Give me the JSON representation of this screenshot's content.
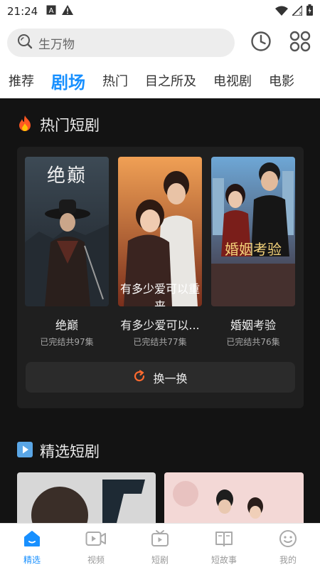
{
  "status_bar": {
    "time": "21:24"
  },
  "search": {
    "placeholder": "生万物"
  },
  "tabs": [
    "推荐",
    "剧场",
    "热门",
    "目之所及",
    "电视剧",
    "电影"
  ],
  "active_tab": "剧场",
  "hot_section": {
    "title": "热门短剧",
    "items": [
      {
        "name": "绝巅",
        "meta": "已完结共97集",
        "poster_text": "绝巅"
      },
      {
        "name": "有多少爱可以...",
        "meta": "已完结共77集",
        "poster_text": "有多少爱可以重来"
      },
      {
        "name": "婚姻考验",
        "meta": "已完结共76集",
        "poster_text": "婚姻考验"
      }
    ],
    "swap_label": "换一换"
  },
  "selected_section": {
    "title": "精选短剧"
  },
  "bottom_nav": [
    {
      "label": "精选",
      "icon": "home-icon"
    },
    {
      "label": "视频",
      "icon": "video-icon"
    },
    {
      "label": "短剧",
      "icon": "tv-icon"
    },
    {
      "label": "短故事",
      "icon": "book-icon"
    },
    {
      "label": "我的",
      "icon": "smile-icon"
    }
  ],
  "colors": {
    "accent": "#1890ff",
    "dark_bg": "#131313",
    "card_bg": "#1f1f1f",
    "swap_icon": "#ff6a2f"
  }
}
